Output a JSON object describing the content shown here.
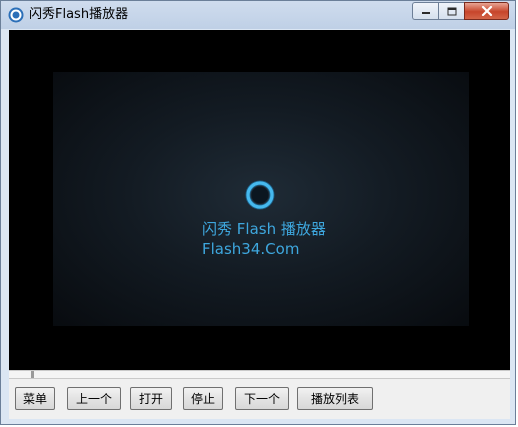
{
  "window": {
    "title": "闪秀Flash播放器"
  },
  "title_controls": {
    "minimize": "minimize-icon",
    "maximize": "maximize-icon",
    "close": "close-icon"
  },
  "video": {
    "brand_line1": "闪秀 Flash 播放器",
    "brand_line2": "Flash34.Com",
    "accent_color": "#3ea7de"
  },
  "toolbar": {
    "menu_label": "菜单",
    "prev_label": "上一个",
    "open_label": "打开",
    "stop_label": "停止",
    "next_label": "下一个",
    "playlist_label": "播放列表"
  }
}
